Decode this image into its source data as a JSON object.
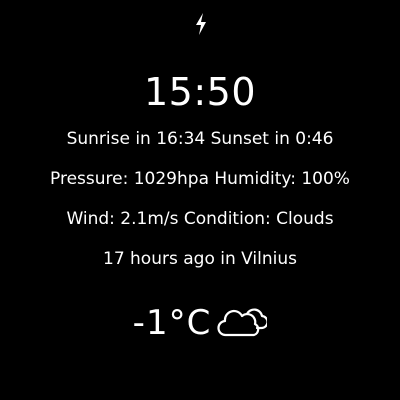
{
  "watchface": {
    "icon": "lightning-bolt-icon",
    "time": "15:50",
    "sun_line": "Sunrise in 16:34 Sunset in 0:46",
    "pressure_line": "Pressure: 1029hpa Humidity: 100%",
    "wind_line": "Wind: 2.1m/s Condition: Clouds",
    "updated_line": "17 hours ago in Vilnius",
    "temperature": "-1°C",
    "weather_icon": "clouds-icon"
  },
  "colors": {
    "background": "#000000",
    "text": "#ffffff"
  }
}
